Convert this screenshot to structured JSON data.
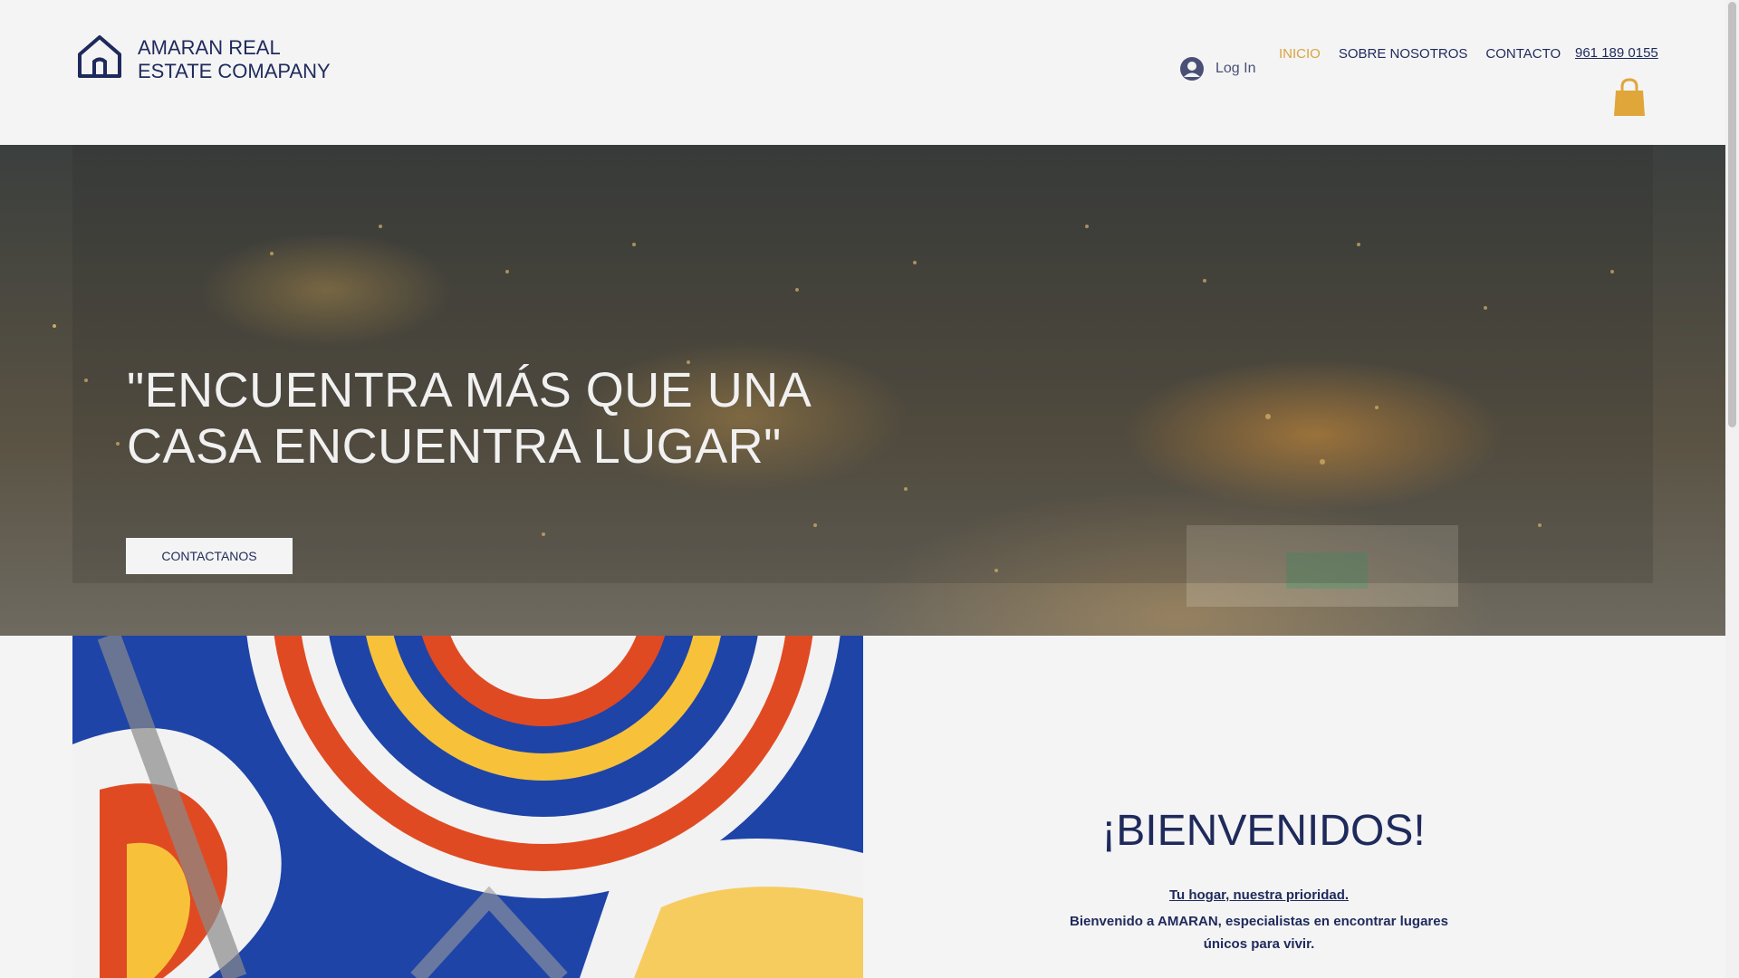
{
  "header": {
    "logo_icon": "house-outline-icon",
    "company_line1": "AMARAN REAL",
    "company_line2": "ESTATE COMAPANY",
    "login_label": "Log In",
    "nav": [
      {
        "label": "INICIO",
        "active": true
      },
      {
        "label": "SOBRE NOSOTROS",
        "active": false
      },
      {
        "label": "CONTACTO",
        "active": false
      }
    ],
    "phone": "961 189 0155",
    "cart_icon": "shopping-bag-icon"
  },
  "hero": {
    "title_line1": "\"ENCUENTRA MÁS QUE UNA",
    "title_line2": "CASA ENCUENTRA LUGAR\"",
    "button_label": "CONTACTANOS"
  },
  "welcome": {
    "title": "¡BIENVENIDOS!",
    "subtitle": "Tu hogar, nuestra prioridad.",
    "body": "Bienvenido a AMARAN, especialistas en encontrar lugares únicos para vivir."
  },
  "colors": {
    "navy": "#1f2a5c",
    "accent_gold": "#d9a441",
    "background": "#f4f4f4"
  }
}
